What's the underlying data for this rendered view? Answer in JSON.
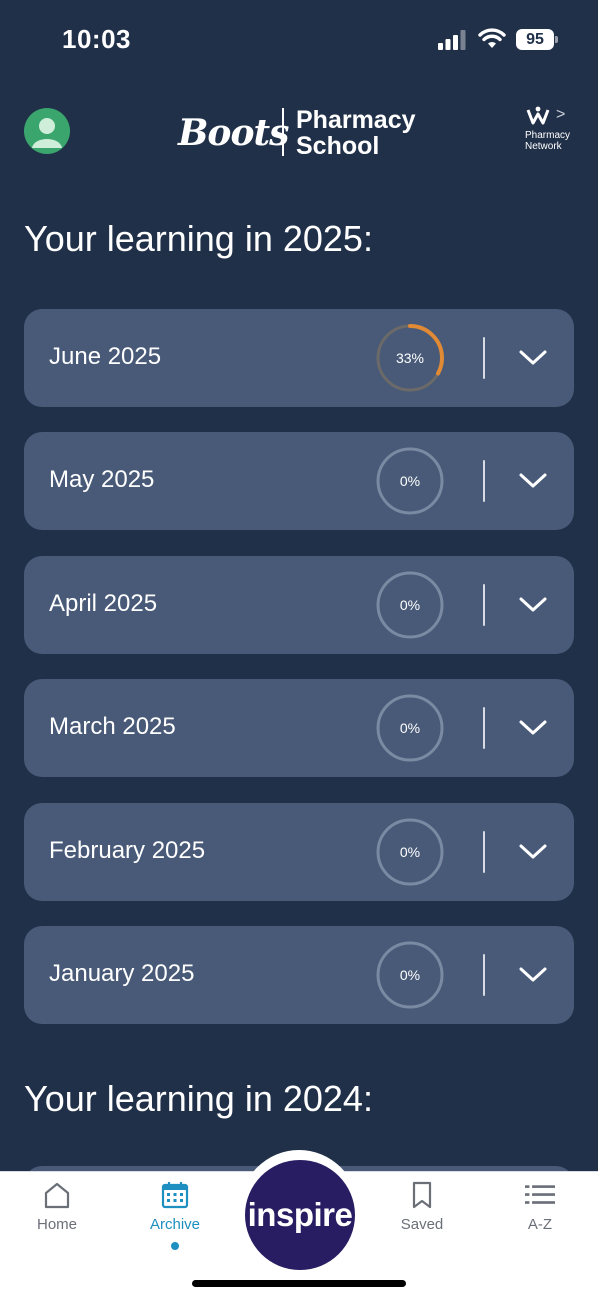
{
  "status_bar": {
    "time": "10:03",
    "battery": "95"
  },
  "header": {
    "brand_boots": "Boots",
    "brand_line1": "Pharmacy",
    "brand_line2": "School",
    "network_line1": "Pharmacy",
    "network_line2": "Network",
    "network_chevron": ">"
  },
  "section_2025": {
    "title": "Your learning in 2025:"
  },
  "months": [
    {
      "label": "June 2025",
      "progress_text": "33%",
      "progress": 0.33
    },
    {
      "label": "May 2025",
      "progress_text": "0%",
      "progress": 0
    },
    {
      "label": "April 2025",
      "progress_text": "0%",
      "progress": 0
    },
    {
      "label": "March 2025",
      "progress_text": "0%",
      "progress": 0
    },
    {
      "label": "February 2025",
      "progress_text": "0%",
      "progress": 0
    },
    {
      "label": "January 2025",
      "progress_text": "0%",
      "progress": 0
    }
  ],
  "section_2024": {
    "title": "Your learning in 2024:"
  },
  "nav": {
    "home": "Home",
    "archive": "Archive",
    "inspire": "inspire",
    "saved": "Saved",
    "az": "A-Z",
    "active": "archive"
  },
  "colors": {
    "background": "#213049",
    "card": "#485a78",
    "progress_accent": "#e08a35",
    "nav_active": "#1d8fc0",
    "inspire": "#281d62",
    "avatar": "#3aa56c"
  }
}
